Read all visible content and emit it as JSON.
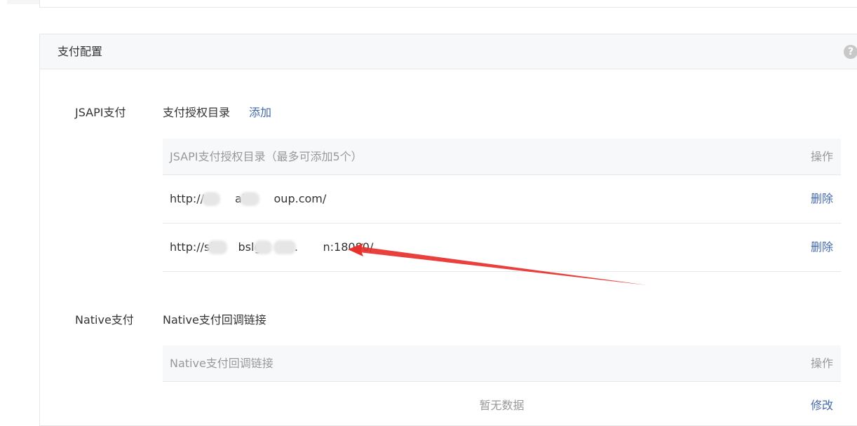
{
  "panel": {
    "title": "支付配置",
    "help_glyph": "?"
  },
  "jsapi": {
    "section_label": "JSAPI支付",
    "sub_title": "支付授权目录",
    "add_label": "添加",
    "table": {
      "header": "JSAPI支付授权目录（最多可添加5个）",
      "op_header": "操作",
      "rows": [
        {
          "url": "http://s       ab       oup.com/",
          "op": "删除"
        },
        {
          "url": "http://sł       bslg:       ).       n:18080/",
          "op": "删除"
        }
      ]
    }
  },
  "native": {
    "section_label": "Native支付",
    "sub_title": "Native支付回调链接",
    "table": {
      "header": "Native支付回调链接",
      "op_header": "操作",
      "empty_text": "暂无数据",
      "op": "修改"
    }
  },
  "colors": {
    "link": "#4569a8",
    "annotation_arrow": "#e8302c"
  }
}
